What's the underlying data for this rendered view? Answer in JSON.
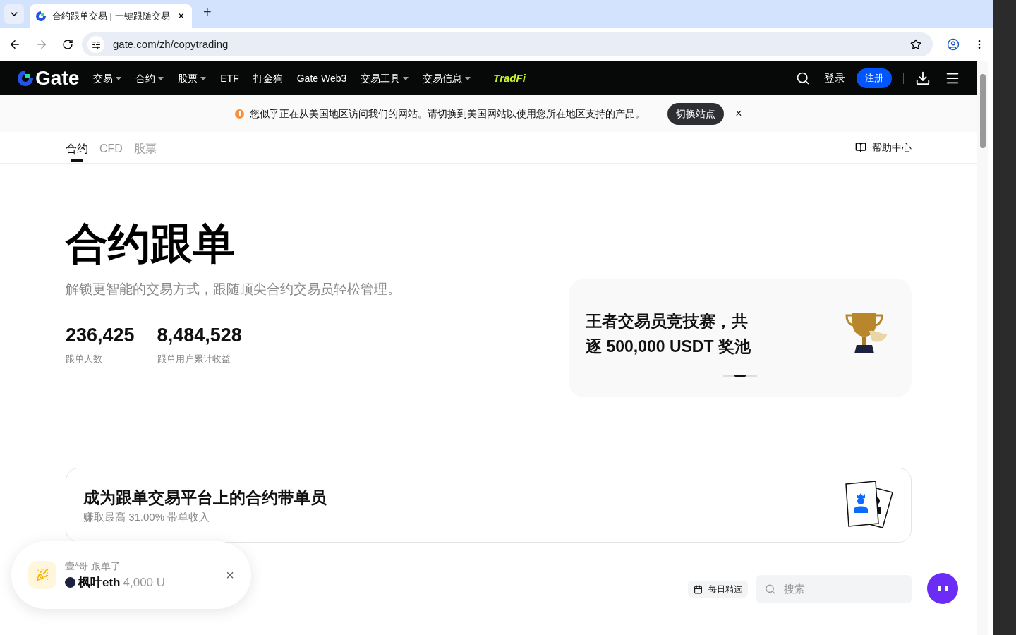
{
  "browser": {
    "tab_title": "合约跟单交易 | 一键跟随交易",
    "tab_close": "×",
    "new_tab": "+",
    "url": "gate.com/zh/copytrading"
  },
  "nav": {
    "logo": "Gate",
    "items": [
      {
        "label": "交易",
        "dropdown": true
      },
      {
        "label": "合约",
        "dropdown": true
      },
      {
        "label": "股票",
        "dropdown": true
      },
      {
        "label": "ETF",
        "dropdown": false
      },
      {
        "label": "打金狗",
        "dropdown": false
      },
      {
        "label": "Gate Web3",
        "dropdown": false
      },
      {
        "label": "交易工具",
        "dropdown": true
      },
      {
        "label": "交易信息",
        "dropdown": true
      }
    ],
    "tradfi": "TradFi",
    "login": "登录",
    "register": "注册"
  },
  "notice": {
    "text": "您似乎正在从美国地区访问我们的网站。请切换到美国网站以使用您所在地区支持的产品。",
    "button": "切换站点",
    "close": "×"
  },
  "subtabs": [
    {
      "label": "合约",
      "selected": true
    },
    {
      "label": "CFD",
      "selected": false
    },
    {
      "label": "股票",
      "selected": false
    }
  ],
  "help": "帮助中心",
  "hero": {
    "title": "合约跟单",
    "subtitle": "解锁更智能的交易方式，跟随顶尖合约交易员轻松管理。",
    "stats": [
      {
        "value": "236,425",
        "label": "跟单人数"
      },
      {
        "value": "8,484,528",
        "label": "跟单用户累计收益"
      }
    ]
  },
  "banner": {
    "title": "王者交易员竞技赛，共逐 500,000 USDT 奖池",
    "slides": [
      {
        "selected": false
      },
      {
        "selected": true
      },
      {
        "selected": false
      }
    ]
  },
  "leader_card": {
    "title": "成为跟单交易平台上的合约带单员",
    "subtitle": "赚取最高 31.00% 带单收入"
  },
  "toast": {
    "line": "壹*哥 跟单了",
    "trader": "枫叶eth",
    "amount": "4,000 U",
    "close": "×"
  },
  "toolbar": {
    "daily": "每日精选",
    "search_placeholder": "搜索"
  }
}
